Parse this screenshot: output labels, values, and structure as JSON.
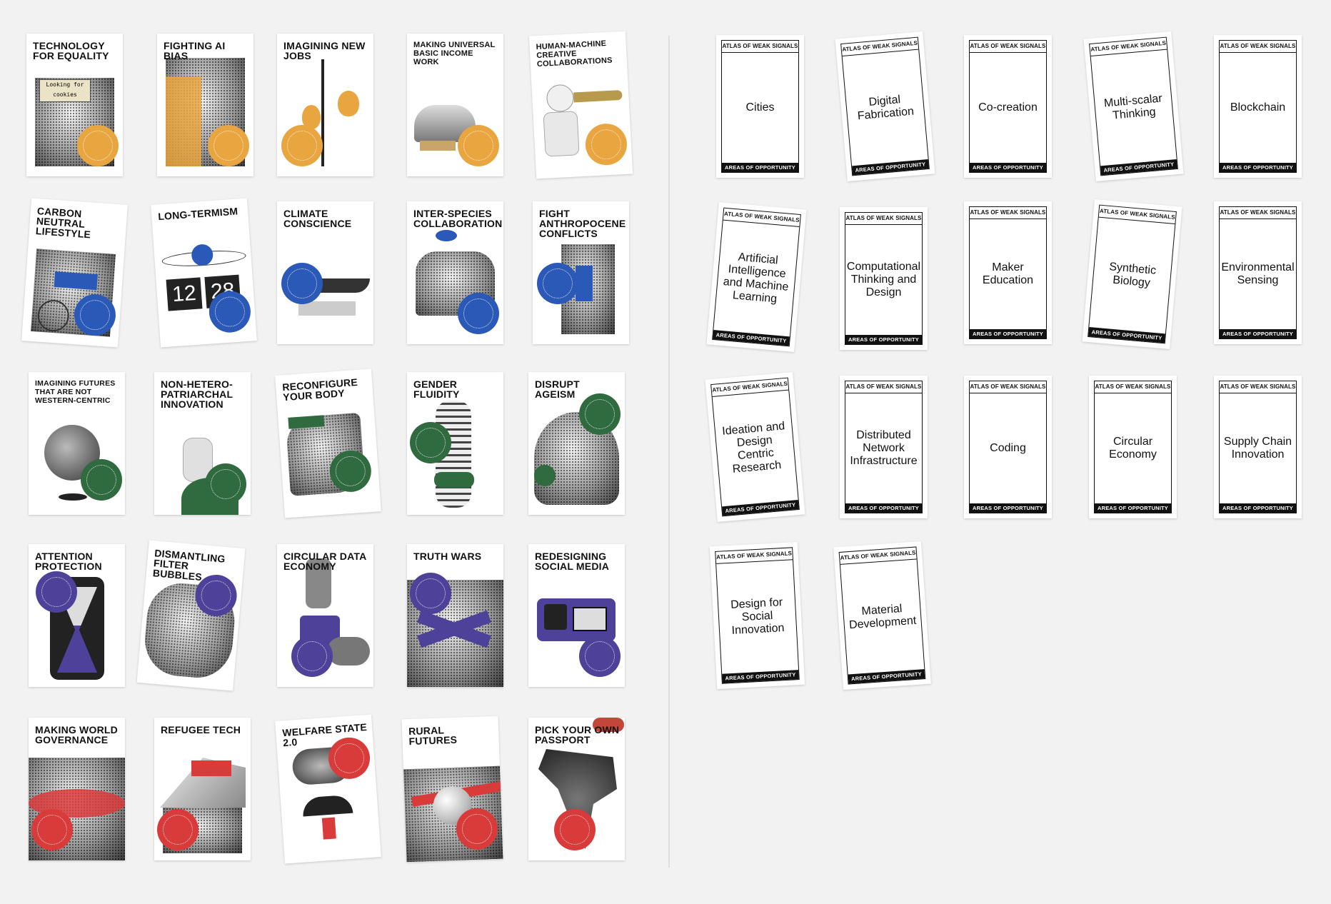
{
  "colors": {
    "background": "#f2f2f2",
    "orange": "#e9a53f",
    "blue": "#2b59b8",
    "green": "#2f6b3e",
    "purple": "#4d4199",
    "red": "#d93a3a"
  },
  "signal_cards": [
    {
      "title": "TECHNOLOGY FOR EQUALITY",
      "color": "orange",
      "caption": "Looking for cookies"
    },
    {
      "title": "FIGHTING AI BIAS",
      "color": "orange"
    },
    {
      "title": "IMAGINING NEW JOBS",
      "color": "orange"
    },
    {
      "title": "MAKING UNIVERSAL BASIC INCOME WORK",
      "color": "orange"
    },
    {
      "title": "HUMAN-MACHINE CREATIVE COLLABORATIONS",
      "color": "orange"
    },
    {
      "title": "CARBON NEUTRAL LIFESTYLE",
      "color": "blue"
    },
    {
      "title": "LONG-TERMISM",
      "color": "blue",
      "caption_left": "12",
      "caption_right": "28"
    },
    {
      "title": "CLIMATE CONSCIENCE",
      "color": "blue"
    },
    {
      "title": "INTER-SPECIES COLLABORATION",
      "color": "blue"
    },
    {
      "title": "FIGHT ANTHROPOCENE CONFLICTS",
      "color": "blue"
    },
    {
      "title": "IMAGINING FUTURES THAT ARE NOT WESTERN-CENTRIC",
      "color": "green"
    },
    {
      "title": "NON-HETERO-PATRIARCHAL INNOVATION",
      "color": "green"
    },
    {
      "title": "RECONFIGURE YOUR BODY",
      "color": "green"
    },
    {
      "title": "GENDER FLUIDITY",
      "color": "green"
    },
    {
      "title": "DISRUPT AGEISM",
      "color": "green"
    },
    {
      "title": "ATTENTION PROTECTION",
      "color": "purple"
    },
    {
      "title": "DISMANTLING FILTER BUBBLES",
      "color": "purple"
    },
    {
      "title": "CIRCULAR DATA ECONOMY",
      "color": "purple"
    },
    {
      "title": "TRUTH WARS",
      "color": "purple"
    },
    {
      "title": "REDESIGNING SOCIAL MEDIA",
      "color": "purple"
    },
    {
      "title": "MAKING WORLD GOVERNANCE",
      "color": "red"
    },
    {
      "title": "REFUGEE TECH",
      "color": "red"
    },
    {
      "title": "WELFARE STATE 2.0",
      "color": "red"
    },
    {
      "title": "RURAL FUTURES",
      "color": "red"
    },
    {
      "title": "PICK YOUR OWN PASSPORT",
      "color": "red"
    }
  ],
  "opportunity_header": "ATLAS OF WEAK SIGNALS",
  "opportunity_footer": "AREAS OF OPPORTUNITY",
  "opportunity_cards": [
    "Cities",
    "Digital Fabrication",
    "Co-creation",
    "Multi-scalar Thinking",
    "Blockchain",
    "Artificial Intelligence and Machine Learning",
    "Computational Thinking and Design",
    "Maker Education",
    "Synthetic Biology",
    "Environmental Sensing",
    "Ideation and Design Centric Research",
    "Distributed Network Infrastructure",
    "Coding",
    "Circular Economy",
    "Supply Chain Innovation",
    "Design for Social Innovation",
    "Material Development"
  ]
}
